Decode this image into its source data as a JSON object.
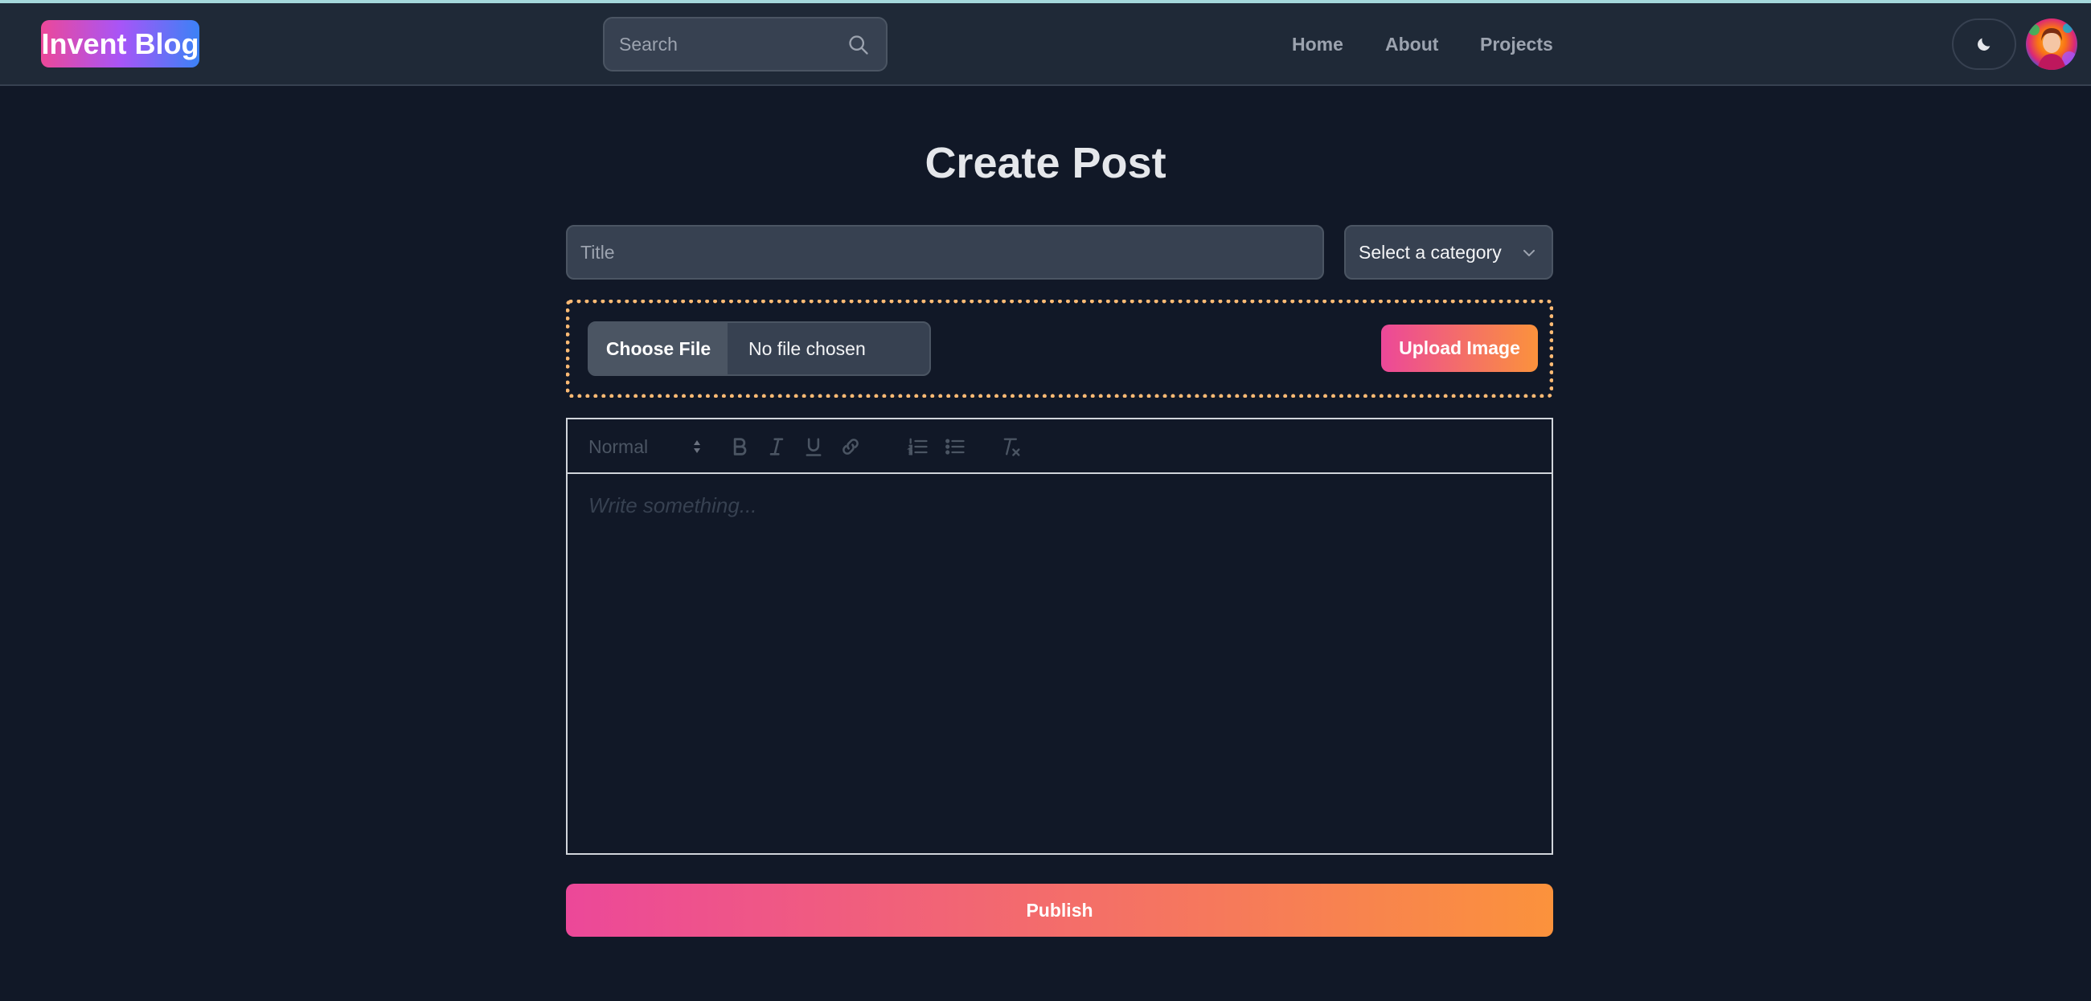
{
  "brand": {
    "name": "Invent Blog"
  },
  "search": {
    "placeholder": "Search"
  },
  "nav": {
    "home": "Home",
    "about": "About",
    "projects": "Projects"
  },
  "page": {
    "title": "Create Post"
  },
  "form": {
    "title_placeholder": "Title",
    "category_selected": "Select a category",
    "file_button": "Choose File",
    "file_status": "No file chosen",
    "upload_button": "Upload Image",
    "editor_format": "Normal",
    "editor_placeholder": "Write something...",
    "publish_button": "Publish"
  },
  "icons": {
    "search": "search-icon",
    "theme": "moon-icon",
    "chevron": "chevron-down-icon",
    "bold": "bold-icon",
    "italic": "italic-icon",
    "underline": "underline-icon",
    "link": "link-icon",
    "ordered_list": "ordered-list-icon",
    "bullet_list": "bullet-list-icon",
    "clean": "clear-format-icon"
  },
  "colors": {
    "background": "#111827",
    "navbar": "#1f2937",
    "accent_start": "#ec4899",
    "accent_end": "#fb923c",
    "dotted_border": "#fdba74"
  }
}
